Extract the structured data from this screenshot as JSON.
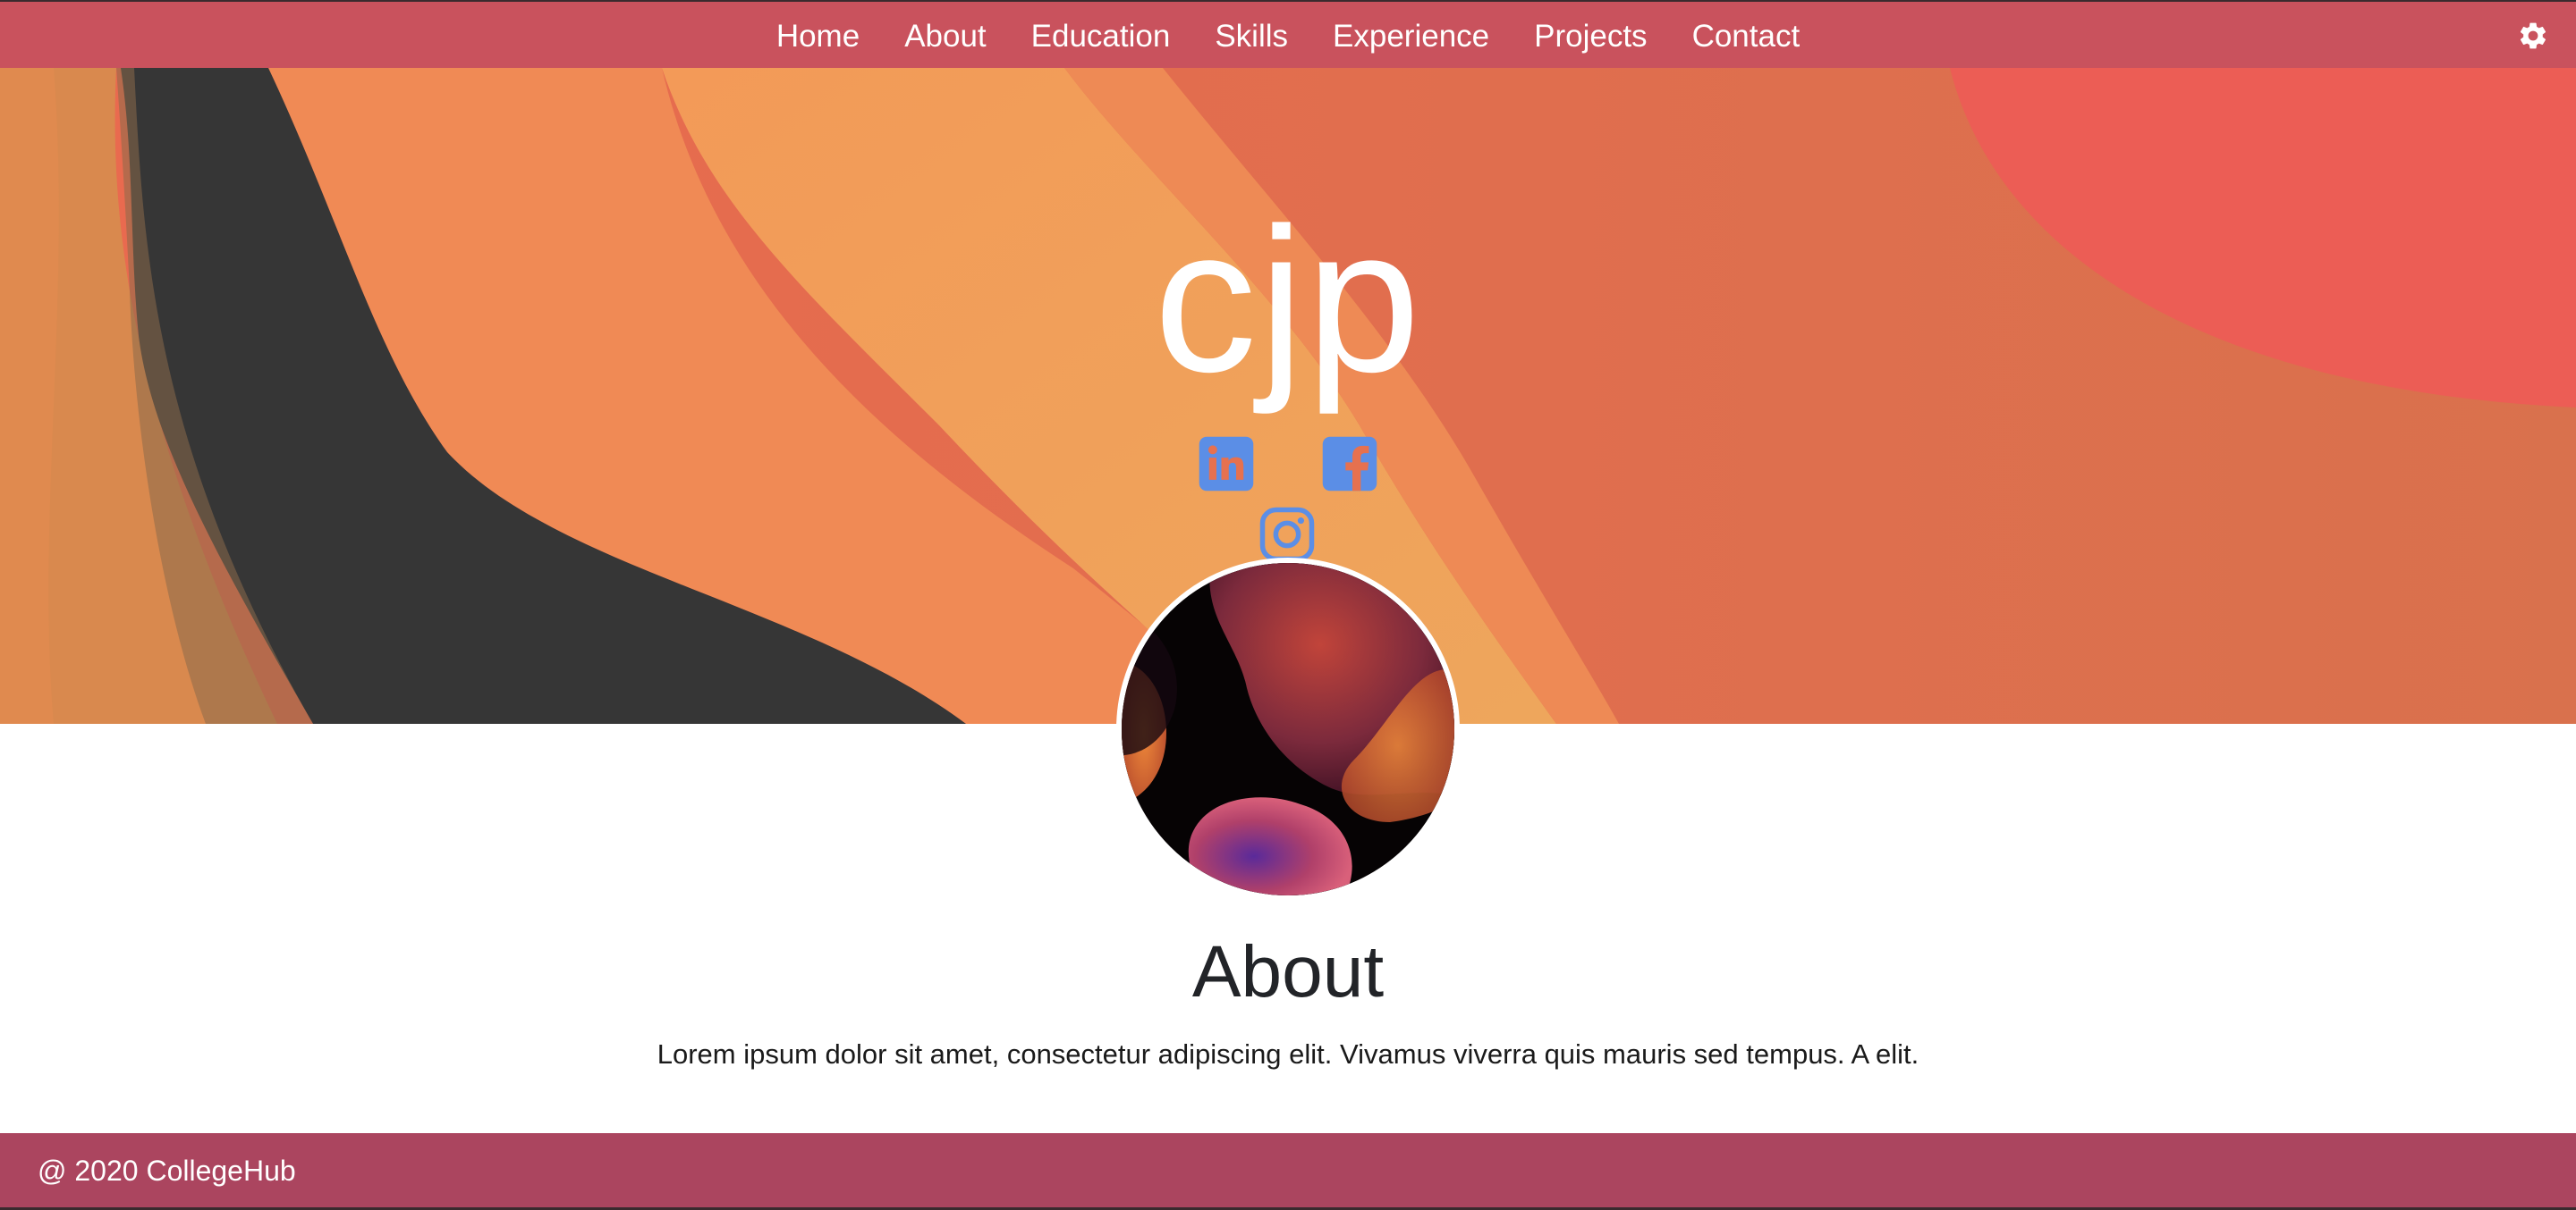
{
  "colors": {
    "navbar": "#c9525d",
    "footer": "#ab455f",
    "social_icon": "#5b8ee6",
    "hero_orange": "#f08a55",
    "hero_dark": "#363636",
    "hero_red": "#e35f50"
  },
  "nav": {
    "items": [
      {
        "label": "Home"
      },
      {
        "label": "About"
      },
      {
        "label": "Education"
      },
      {
        "label": "Skills"
      },
      {
        "label": "Experience"
      },
      {
        "label": "Projects"
      },
      {
        "label": "Contact"
      }
    ],
    "settings_icon": "gear-icon"
  },
  "hero": {
    "title": "cjp",
    "social_icons": [
      "linkedin-icon",
      "facebook-icon",
      "instagram-icon"
    ]
  },
  "about": {
    "heading": "About",
    "text": "Lorem ipsum dolor sit amet, consectetur adipiscing elit. Vivamus viverra quis mauris sed tempus. A elit."
  },
  "footer": {
    "text": "@ 2020 CollegeHub"
  }
}
